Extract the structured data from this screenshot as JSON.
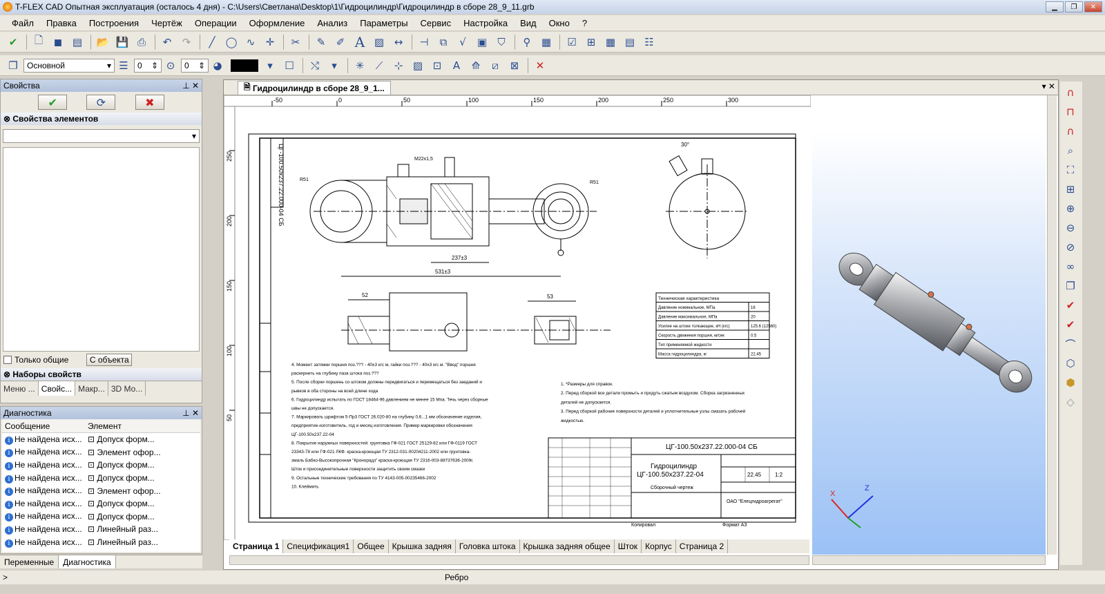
{
  "window": {
    "title": "T-FLEX CAD Опытная эксплуатация (осталось 4 дня) - C:\\Users\\Светлана\\Desktop\\1\\Гидроцилиндр\\Гидроцилиндр в сборе  28_9_11.grb"
  },
  "menu": [
    "Файл",
    "Правка",
    "Построения",
    "Чертёж",
    "Операции",
    "Оформление",
    "Анализ",
    "Параметры",
    "Сервис",
    "Настройка",
    "Вид",
    "Окно",
    "?"
  ],
  "toolbar2": {
    "style_value": "Основной",
    "layer_value": "0",
    "level_value": "0"
  },
  "properties_panel": {
    "title": "Свойства",
    "section_elements": "Свойства элементов",
    "only_common_label": "Только общие",
    "from_object_button": "С объекта",
    "section_sets": "Наборы свойств",
    "tabs": [
      "Меню ...",
      "Свойс...",
      "Макр...",
      "3D Мо..."
    ]
  },
  "diagnostics_panel": {
    "title": "Диагностика",
    "col_message": "Сообщение",
    "col_element": "Элемент",
    "rows": [
      {
        "message": "Не найдена исх...",
        "element": "Допуск форм..."
      },
      {
        "message": "Не найдена исх...",
        "element": "Элемент офор..."
      },
      {
        "message": "Не найдена исх...",
        "element": "Допуск форм..."
      },
      {
        "message": "Не найдена исх...",
        "element": "Допуск форм..."
      },
      {
        "message": "Не найдена исх...",
        "element": "Элемент офор..."
      },
      {
        "message": "Не найдена исх...",
        "element": "Допуск форм..."
      },
      {
        "message": "Не найдена исх...",
        "element": "Допуск форм..."
      },
      {
        "message": "Не найдена исх...",
        "element": "Линейный раз..."
      },
      {
        "message": "Не найдена исх...",
        "element": "Линейный раз..."
      }
    ]
  },
  "bottom_tabs": [
    "Переменные",
    "Диагностика"
  ],
  "document": {
    "tab_title": "Гидроцилиндр в сборе  28_9_1...",
    "ruler_top": [
      "-50",
      "0",
      "50",
      "100",
      "150",
      "200",
      "250",
      "300"
    ],
    "ruler_left": [
      "250",
      "200",
      "150",
      "100",
      "50"
    ],
    "page_tabs": [
      "Страница 1",
      "Спецификация1",
      "Общее",
      "Крышка задняя",
      "Головка штока",
      "Крышка задняя общее",
      "Шток",
      "Корпус",
      "Страница 2"
    ],
    "title_block": {
      "designation": "ЦГ-100.50х237.22.000-04 СБ",
      "name_line1": "Гидроцилиндр",
      "name_line2": "ЦГ-100.50х237.22-04",
      "doc_type": "Сборочный чертеж",
      "mass": "22.45",
      "scale": "1:2",
      "org": "ОАО \"Елецгидроагрегат\"",
      "format": "Формат  А3",
      "copied": "Копировал"
    },
    "tech_table": {
      "title": "Техническая характеристика",
      "rows": [
        [
          "Давление номинальное, МПа",
          "16"
        ],
        [
          "Давление максимальное, МПа",
          "20"
        ],
        [
          "Усилие на штоке толкающее, кН (кгс)",
          "125.6 (12560)"
        ],
        [
          "Скорость движения поршня, м/сек",
          "0.5"
        ],
        [
          "Тип применяемой жидкости",
          ""
        ],
        [
          "Масса гидроцилиндра, кг",
          "22.45"
        ]
      ]
    },
    "notes_left": [
      "4. Момент затяжки поршня поз.??? - 40±3 кгс м, гайки поз.??? - 40±3 кгс м. \"Ввод\" поршня",
      "раскернить на глубину паза штока поз.???",
      "5. После сборки поршень со штоком должны передвигаться и перемещаться без заеданий и",
      "рывков в оба стороны на всей длине хода",
      "6. Гидроцилиндр испытать по ГОСТ 18464-96 давлением не менее 15 Мпа. Течь через сборные",
      "швы не допускается.",
      "7. Маркировать шрифтом 5-Пр3 ГОСТ 26.020-80 на глубину 0,6...1 мм обозначение изделия,",
      "предприятие-изготовитель, год и месяц изготовления. Пример маркировки обозначения",
      "ЦГ-100.50х237.22-04",
      "8. Покрытие наружных поверхностей: грунтовка ГФ-021 ГОСТ 25129-82 или ГФ-0119 ГОСТ",
      "23343-78 или ГФ-021 ЛКФ. краска-кроющая ТУ 2312-031-00204211-2002 или грунтовка-",
      "эмаль Бабко-Высокопрочная \"Кронорадз\" краска-кроющая ТУ 2316-003-88737636-2009г.",
      "Шток и присоединительные поверхности защитить своим смазки",
      "9. Остальные технические требования по ТУ 4143-005-00235466-2002",
      "10. Клеймить"
    ],
    "notes_right": [
      "1. *Размеры для справок.",
      "2. Перед сборкой все детали промыть и продуть сжатым воздухом. Сборка загрязненных",
      "деталей не допускается.",
      "3. Перед сборкой рабочие поверхности деталей и уплотнительные узлы смазать рабочей",
      "жидкостью."
    ],
    "stamp_left": "ЦГ-100.50х237.22.000-04 СБ",
    "dims": [
      "531±3",
      "237±3",
      "52",
      "53",
      "М22х1,5",
      "R51",
      "R51",
      "30°"
    ]
  },
  "view3d": {
    "axis_x": "X",
    "axis_z": "Z"
  },
  "status": {
    "text": "Ребро",
    "prompt": ">"
  },
  "colors": {
    "title_bar": "#c5d3e8",
    "panel_bg": "#ece9e1",
    "view3d_bottom": "#9bc1f5",
    "diag_info": "#2e6fd0"
  }
}
